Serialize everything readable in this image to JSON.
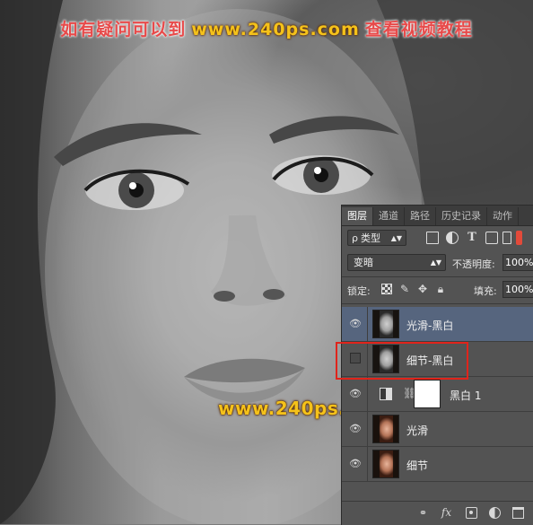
{
  "watermark": {
    "top_left_text": "如有疑问可以到",
    "url": "www.240ps.com",
    "top_right_text": "查看视频教程",
    "mid_url": "www.240ps.com"
  },
  "layers_panel": {
    "tabs": [
      "图层",
      "通道",
      "路径",
      "历史记录",
      "动作"
    ],
    "active_tab": "图层",
    "filter": {
      "prefix": "ρ",
      "value": "类型"
    },
    "blend_mode": "变暗",
    "opacity_label": "不透明度:",
    "opacity_value": "100%",
    "lock_label": "锁定:",
    "fill_label": "填充:",
    "fill_value": "100%",
    "layers": [
      {
        "name": "光滑-黑白",
        "thumb": "gray",
        "visible": true,
        "selected": true
      },
      {
        "name": "细节-黑白",
        "thumb": "gray",
        "visible": false,
        "selected": false
      },
      {
        "name": "黑白 1",
        "thumb": "adjustment",
        "visible": true,
        "selected": false
      },
      {
        "name": "光滑",
        "thumb": "color",
        "visible": true,
        "selected": false
      },
      {
        "name": "细节",
        "thumb": "color",
        "visible": true,
        "selected": false
      }
    ],
    "bottom_icons": [
      "link-icon",
      "fx-icon",
      "mask-icon",
      "adjustment-icon",
      "folder-icon"
    ]
  },
  "colors": {
    "panel_bg": "#535353",
    "selected_layer": "#56657e",
    "highlight_box": "#e0241b",
    "watermark_red": "#e84a4a",
    "watermark_yellow": "#f5c21a"
  }
}
